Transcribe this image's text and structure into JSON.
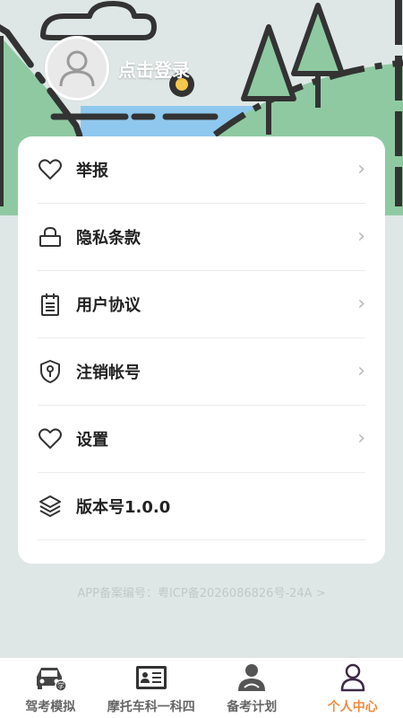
{
  "profile": {
    "login_label": "点击登录"
  },
  "menu": [
    {
      "name": "report",
      "label": "举报",
      "icon": "heart-icon",
      "has_chevron": true
    },
    {
      "name": "privacy",
      "label": "隐私条款",
      "icon": "lock-icon",
      "has_chevron": true
    },
    {
      "name": "agreement",
      "label": "用户协议",
      "icon": "clipboard-icon",
      "has_chevron": true
    },
    {
      "name": "cancel-account",
      "label": "注销帐号",
      "icon": "shield-icon",
      "has_chevron": true
    },
    {
      "name": "settings",
      "label": "设置",
      "icon": "heart-icon",
      "has_chevron": true
    },
    {
      "name": "version",
      "label": "版本号1.0.0",
      "icon": "layers-icon",
      "has_chevron": false
    }
  ],
  "chevron": "›",
  "footer": {
    "icp": "APP备案编号：粤ICP备2026086826号-24A >"
  },
  "tabs": [
    {
      "label": "驾考模拟",
      "icon": "car-icon",
      "active": false
    },
    {
      "label": "摩托车科一科四",
      "icon": "id-card-icon",
      "active": false
    },
    {
      "label": "备考计划",
      "icon": "driver-icon",
      "active": false
    },
    {
      "label": "个人中心",
      "icon": "person-icon",
      "active": true
    }
  ],
  "colors": {
    "background": "#dfe7e6",
    "accent": "#f08a3c",
    "hill_green": "#8fc9a2",
    "water_blue": "#8fc8ee",
    "outline": "#333333"
  }
}
